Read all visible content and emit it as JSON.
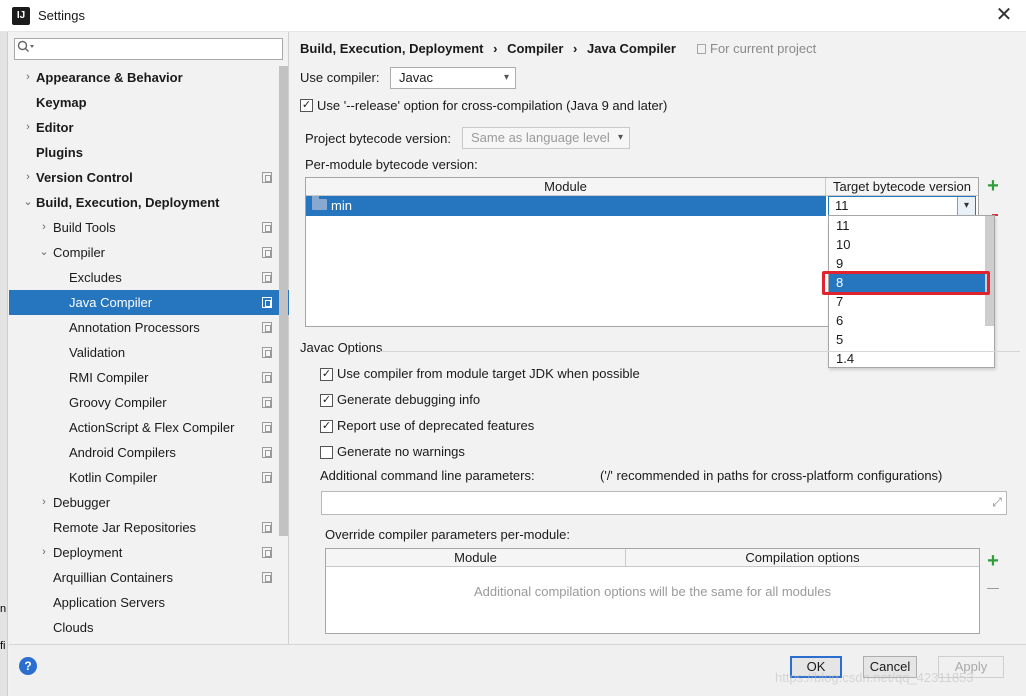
{
  "window": {
    "title": "Settings",
    "close_glyph": "✕",
    "app_icon_text": "IJ"
  },
  "sidebar": {
    "search": {
      "value": "",
      "placeholder": ""
    },
    "items": [
      {
        "label": "Appearance & Behavior",
        "arrow": "›",
        "bold": true
      },
      {
        "label": "Keymap",
        "arrow": "",
        "bold": true
      },
      {
        "label": "Editor",
        "arrow": "›",
        "bold": true
      },
      {
        "label": "Plugins",
        "arrow": "",
        "bold": true
      },
      {
        "label": "Version Control",
        "arrow": "›",
        "bold": true,
        "project": true
      },
      {
        "label": "Build, Execution, Deployment",
        "arrow": "⌄",
        "bold": true
      },
      {
        "label": "Build Tools",
        "arrow": "›",
        "project": true
      },
      {
        "label": "Compiler",
        "arrow": "⌄",
        "project": true
      },
      {
        "label": "Excludes",
        "project": true
      },
      {
        "label": "Java Compiler",
        "project": true,
        "selected": true
      },
      {
        "label": "Annotation Processors",
        "project": true
      },
      {
        "label": "Validation",
        "project": true
      },
      {
        "label": "RMI Compiler",
        "project": true
      },
      {
        "label": "Groovy Compiler",
        "project": true
      },
      {
        "label": "ActionScript & Flex Compiler",
        "project": true
      },
      {
        "label": "Android Compilers",
        "project": true
      },
      {
        "label": "Kotlin Compiler",
        "project": true
      },
      {
        "label": "Debugger",
        "arrow": "›"
      },
      {
        "label": "Remote Jar Repositories",
        "project": true
      },
      {
        "label": "Deployment",
        "arrow": "›",
        "project": true
      },
      {
        "label": "Arquillian Containers",
        "project": true
      },
      {
        "label": "Application Servers"
      },
      {
        "label": "Clouds"
      }
    ]
  },
  "breadcrumb": {
    "parts": [
      "Build, Execution, Deployment",
      "›",
      "Compiler",
      "›",
      "Java Compiler"
    ],
    "scope": "For current project"
  },
  "use_compiler": {
    "label": "Use compiler:",
    "value": "Javac"
  },
  "release_option": {
    "label": "Use '--release' option for cross-compilation (Java 9 and later)",
    "checked": true
  },
  "project_bytecode": {
    "label": "Project bytecode version:",
    "value": "Same as language level"
  },
  "per_module": {
    "label": "Per-module bytecode version:",
    "headers": {
      "module": "Module",
      "target": "Target bytecode version"
    },
    "rows": [
      {
        "module": "min",
        "target": "11"
      }
    ],
    "add": "+"
  },
  "dropdown": {
    "options": [
      "11",
      "10",
      "9",
      "8",
      "7",
      "6",
      "5",
      "1.4"
    ],
    "selected": "8"
  },
  "javac_options": {
    "title": "Javac Options",
    "checkboxes": [
      {
        "label": "Use compiler from module target JDK when possible",
        "checked": true
      },
      {
        "label": "Generate debugging info",
        "checked": true
      },
      {
        "label": "Report use of deprecated features",
        "checked": true
      },
      {
        "label": "Generate no warnings",
        "checked": false
      }
    ],
    "additional_label": "Additional command line parameters:",
    "additional_hint": "('/' recommended in paths for cross-platform configurations)",
    "additional_value": ""
  },
  "override": {
    "label": "Override compiler parameters per-module:",
    "headers": {
      "module": "Module",
      "options": "Compilation options"
    },
    "empty_text": "Additional compilation options will be the same for all modules",
    "add": "+"
  },
  "buttons": {
    "ok": "OK",
    "cancel": "Cancel",
    "apply": "Apply",
    "help": "?"
  },
  "watermark": "https://blog.csdn.net/qq_42311853",
  "left_fragments": [
    "n",
    "fi"
  ],
  "colors": {
    "accent": "#2675bf",
    "highlight_box": "#e0232f",
    "add_green": "#2e9d3a"
  }
}
